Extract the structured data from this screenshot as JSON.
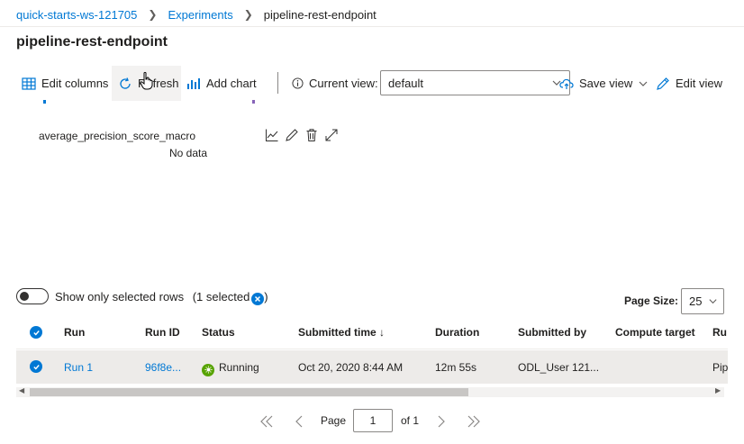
{
  "breadcrumb": {
    "workspace": "quick-starts-ws-121705",
    "experiments": "Experiments",
    "current": "pipeline-rest-endpoint"
  },
  "page": {
    "title": "pipeline-rest-endpoint"
  },
  "toolbar": {
    "edit_columns": "Edit columns",
    "refresh": "Refresh",
    "add_chart": "Add chart",
    "current_view_label": "Current view:",
    "current_view_value": "default",
    "save_view": "Save view",
    "edit_view": "Edit view"
  },
  "chart": {
    "metric_name": "average_precision_score_macro",
    "no_data": "No data"
  },
  "selection": {
    "toggle_label": "Show only selected rows",
    "selected_count": "(1 selected",
    "selected_close": ")"
  },
  "page_size": {
    "label": "Page Size:",
    "value": "25"
  },
  "table": {
    "columns": {
      "run": "Run",
      "run_id": "Run ID",
      "status": "Status",
      "submitted_time": "Submitted time ↓",
      "duration": "Duration",
      "submitted_by": "Submitted by",
      "compute_target": "Compute target",
      "run_type": "Ru"
    },
    "rows": [
      {
        "run": "Run 1",
        "run_id": "96f8e...",
        "status": "Running",
        "submitted_time": "Oct 20, 2020 8:44 AM",
        "duration": "12m 55s",
        "submitted_by": "ODL_User 121...",
        "compute_target": "",
        "run_type": "Pip"
      }
    ]
  },
  "pagination": {
    "page_label": "Page",
    "page_value": "1",
    "of_label": "of 1"
  },
  "colors": {
    "accent": "#0078d4",
    "running": "#57a300",
    "row_selected": "#edebe9"
  }
}
